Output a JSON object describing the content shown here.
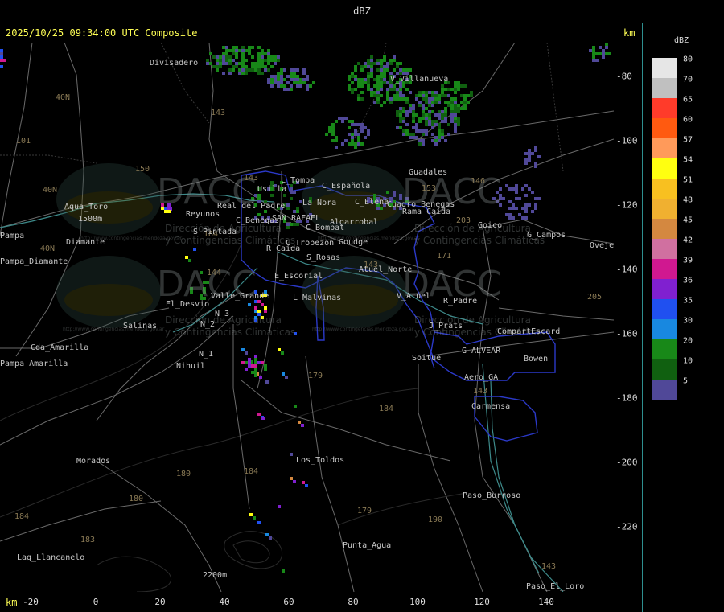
{
  "title": "dBZ",
  "timestamp": "2025/10/25 09:34:00 UTC Composite",
  "km_label": "km",
  "x_ticks": [
    "-20",
    "0",
    "20",
    "40",
    "60",
    "80",
    "100",
    "120",
    "140"
  ],
  "y_ticks": [
    "-80",
    "-100",
    "-120",
    "-140",
    "-160",
    "-180",
    "-200",
    "-220"
  ],
  "legend": {
    "title": "dBZ",
    "entries": [
      {
        "value": "80",
        "color": "#e6e6e6"
      },
      {
        "value": "70",
        "color": "#c0c0c0"
      },
      {
        "value": "65",
        "color": "#ff3b2a"
      },
      {
        "value": "60",
        "color": "#ff5a10"
      },
      {
        "value": "57",
        "color": "#ff9a5a"
      },
      {
        "value": "54",
        "color": "#ffff10"
      },
      {
        "value": "51",
        "color": "#f8c020"
      },
      {
        "value": "48",
        "color": "#f0b030"
      },
      {
        "value": "45",
        "color": "#d48840"
      },
      {
        "value": "42",
        "color": "#d070a0"
      },
      {
        "value": "39",
        "color": "#d01890"
      },
      {
        "value": "36",
        "color": "#8020d0"
      },
      {
        "value": "35",
        "color": "#2050f0"
      },
      {
        "value": "30",
        "color": "#1888e0"
      },
      {
        "value": "20",
        "color": "#188818"
      },
      {
        "value": "10",
        "color": "#106010"
      },
      {
        "value": "5",
        "color": "#504898"
      }
    ]
  },
  "places": [
    {
      "name": "Divisadero"
    },
    {
      "name": "V_Villanueva"
    },
    {
      "name": "Guadales"
    },
    {
      "name": "L_Tomba"
    },
    {
      "name": "Usilla"
    },
    {
      "name": "C_Española"
    },
    {
      "name": "La_Nora"
    },
    {
      "name": "C_Elena"
    },
    {
      "name": "Cuadro Benegas"
    },
    {
      "name": "Rama Caída"
    },
    {
      "name": "Real del Padre"
    },
    {
      "name": "Aqua_Toro"
    },
    {
      "name": "Reyunos"
    },
    {
      "name": "S_Pintada"
    },
    {
      "name": "C_Benegas"
    },
    {
      "name": "SAN_RAFAEL"
    },
    {
      "name": "Algarrobal"
    },
    {
      "name": "C_Bombal"
    },
    {
      "name": "Goico"
    },
    {
      "name": "G_Campos"
    },
    {
      "name": "Ovejeria"
    },
    {
      "name": "C_Tropezon"
    },
    {
      "name": "Goudge"
    },
    {
      "name": "R_Caida"
    },
    {
      "name": "S_Rosas"
    },
    {
      "name": "Pampa_Diamante"
    },
    {
      "name": "Diamante"
    },
    {
      "name": "Pampa"
    },
    {
      "name": "Atuel_Norte"
    },
    {
      "name": "E_Escorial"
    },
    {
      "name": "Valle_Grande"
    },
    {
      "name": "L_Malvinas"
    },
    {
      "name": "V_Atuel"
    },
    {
      "name": "R_Padre"
    },
    {
      "name": "El_Desvio"
    },
    {
      "name": "N_3"
    },
    {
      "name": "J_Prats"
    },
    {
      "name": "CompartEscard"
    },
    {
      "name": "Salinas"
    },
    {
      "name": "N_2"
    },
    {
      "name": "Cda_Amarilla"
    },
    {
      "name": "G_ALVEAR"
    },
    {
      "name": "N_1"
    },
    {
      "name": "Soitue"
    },
    {
      "name": "Bowen"
    },
    {
      "name": "Nihuil"
    },
    {
      "name": "Aero_GA"
    },
    {
      "name": "Carmensa"
    },
    {
      "name": "Los_Toldos"
    },
    {
      "name": "Morados"
    },
    {
      "name": "Paso_Burroso"
    },
    {
      "name": "Punta_Agua"
    },
    {
      "name": "Lag_Llancanelo"
    },
    {
      "name": "Paso_El_Loro"
    },
    {
      "name": "Pampa_Amarilla"
    },
    {
      "name": "1500m"
    },
    {
      "name": "2200m"
    }
  ],
  "route_labels": [
    "143",
    "150",
    "40N",
    "101",
    "40N",
    "143",
    "153",
    "146",
    "203",
    "171",
    "143",
    "144",
    "40N",
    "180",
    "184",
    "179",
    "184",
    "180",
    "184",
    "179",
    "190",
    "183",
    "184",
    "143",
    "143",
    "205"
  ],
  "watermark": {
    "brand": "DACC",
    "subtitle_line1": "Dirección de Agricultura",
    "subtitle_line2": "y Contingencias Climáticas",
    "url": "http://www.contingencias.mendoza.gov.ar"
  },
  "map_colors": {
    "background": "#000000",
    "frame": "#2e8f8f",
    "dept_border": "#2b39c8",
    "roads": "#6e6e6e",
    "routes": "#5a4a2a",
    "rivers": "#3d8a8a",
    "relief": "#2b2b2b"
  }
}
